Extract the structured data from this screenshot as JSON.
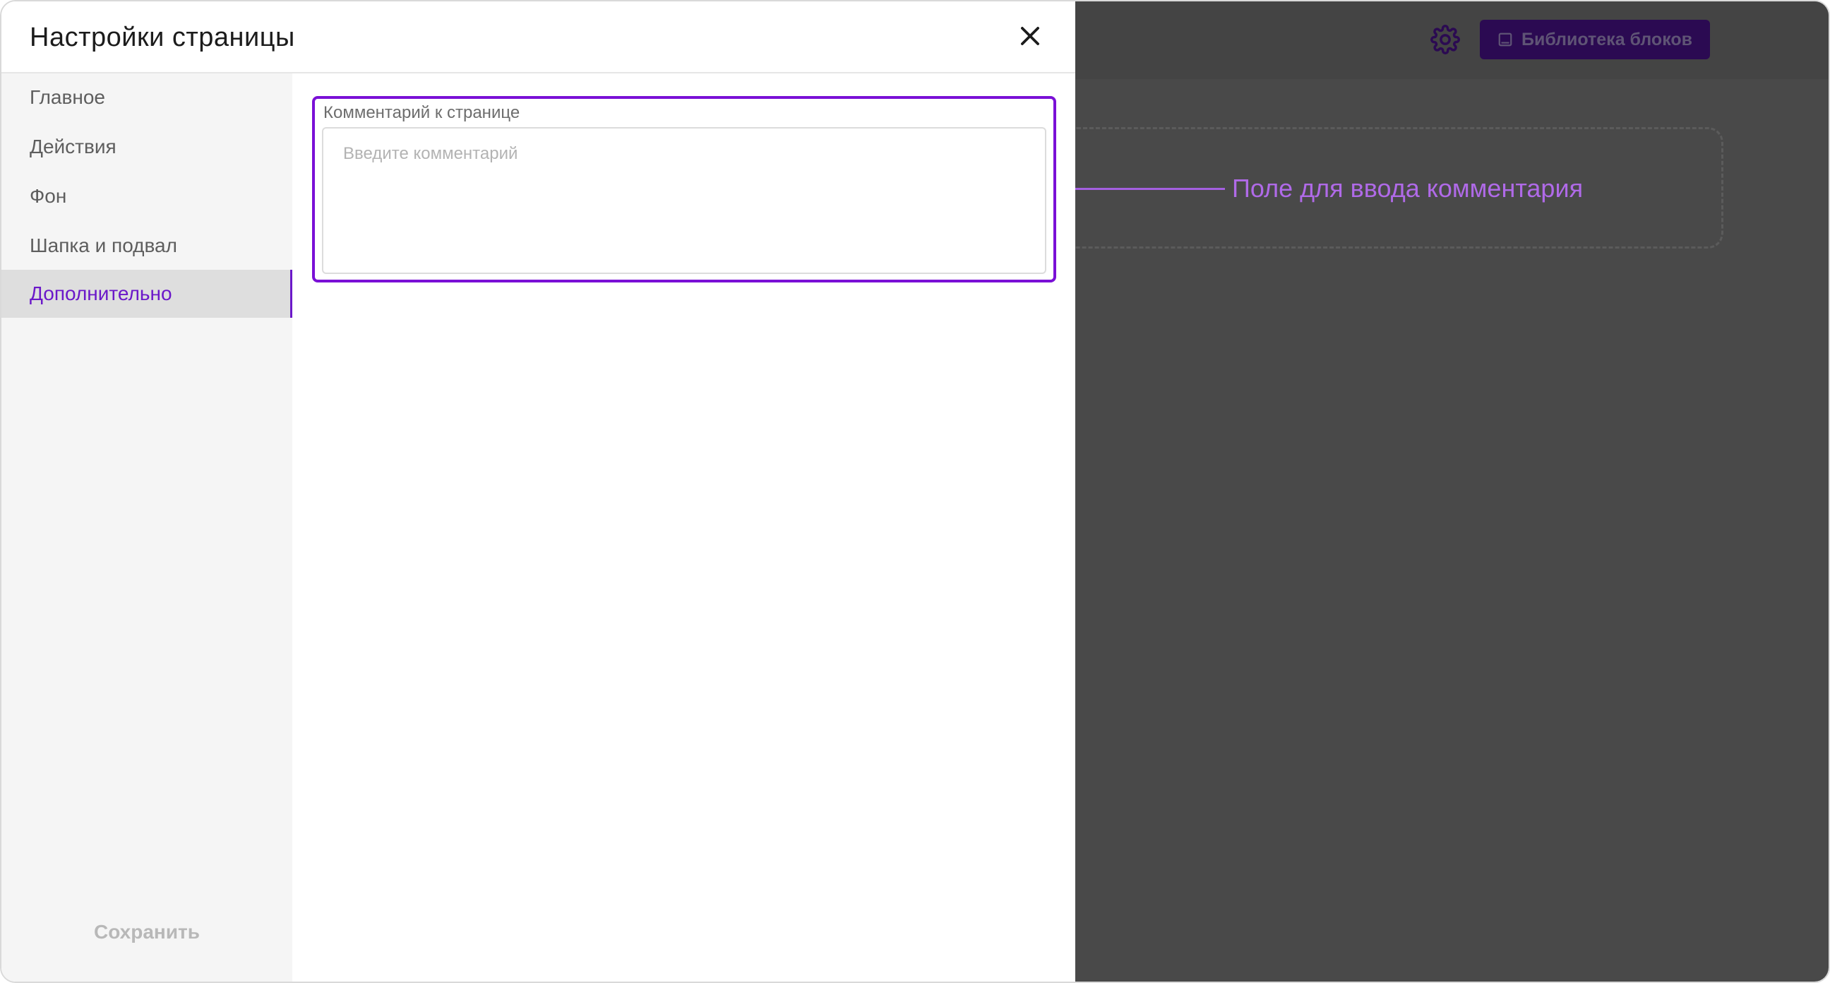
{
  "modal": {
    "title": "Настройки страницы",
    "nav": [
      {
        "label": "Главное",
        "active": false
      },
      {
        "label": "Действия",
        "active": false
      },
      {
        "label": "Фон",
        "active": false
      },
      {
        "label": "Шапка и подвал",
        "active": false
      },
      {
        "label": "Дополнительно",
        "active": true
      }
    ],
    "save_label": "Сохранить",
    "comment_field": {
      "label": "Комментарий к странице",
      "value": "",
      "placeholder": "Введите комментарий"
    }
  },
  "background": {
    "library_button_label": "Библиотека блоков"
  },
  "annotation": {
    "text": "Поле для ввода комментария"
  },
  "colors": {
    "accent": "#6b18c9",
    "annotation": "#b06ae8",
    "overlay": "#494949"
  }
}
